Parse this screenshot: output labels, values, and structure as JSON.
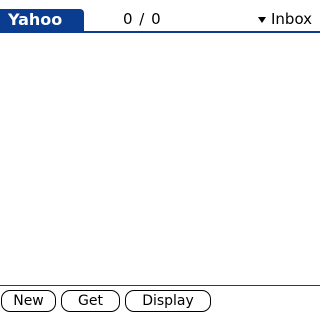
{
  "header": {
    "app_title": "Yahoo",
    "message_count": "0 / 0",
    "folder": {
      "label": "Inbox",
      "icon": "dropdown-triangle-icon"
    }
  },
  "toolbar": {
    "new_label": "New",
    "get_label": "Get",
    "display_label": "Display"
  },
  "colors": {
    "accent": "#0a3d8f",
    "background": "#ffffff"
  }
}
